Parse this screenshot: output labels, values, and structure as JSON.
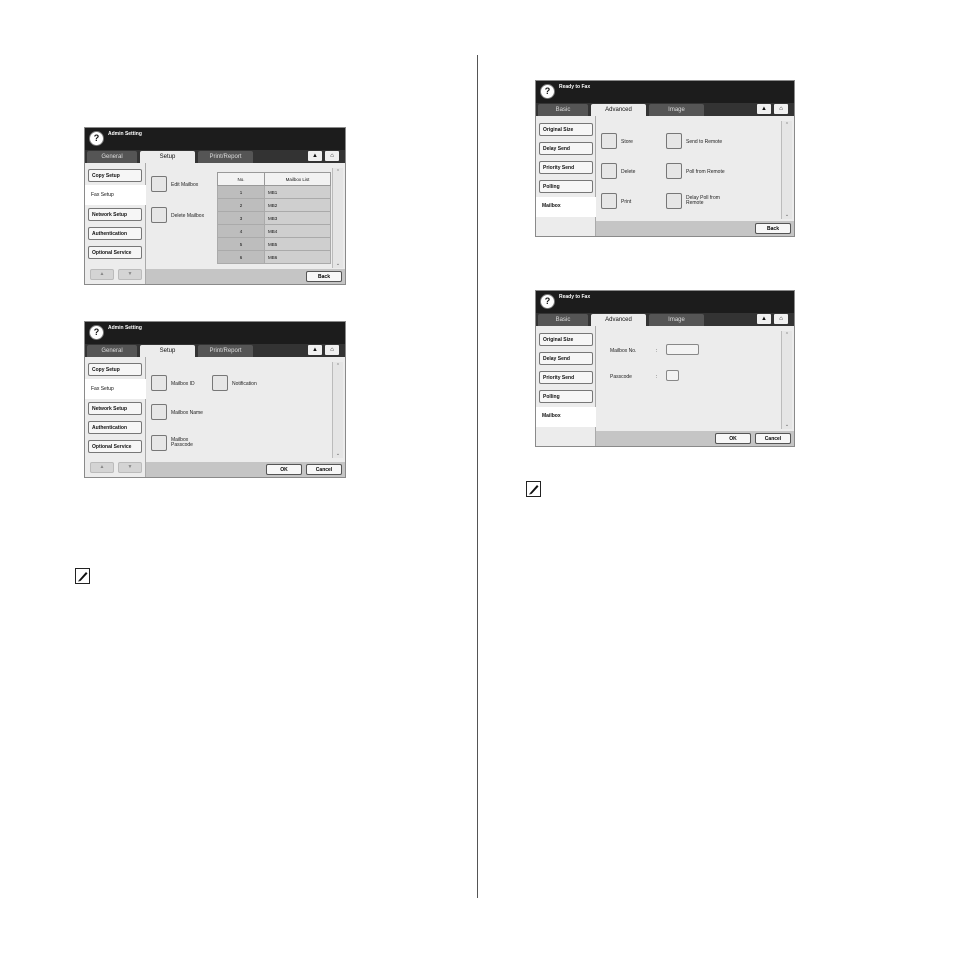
{
  "p1": {
    "title": "Admin Setting",
    "tabs": [
      "General",
      "Setup",
      "Print/Report"
    ],
    "sidebar": [
      "Copy Setup",
      "Fax Setup",
      "Network Setup",
      "Authentication",
      "Optional Service"
    ],
    "buttons": [
      "Edit Mailbox",
      "Delete Mailbox"
    ],
    "table_headers": [
      "No.",
      "Mailbox List"
    ],
    "rows": [
      [
        "1",
        "MB1"
      ],
      [
        "2",
        "MB2"
      ],
      [
        "3",
        "MB3"
      ],
      [
        "4",
        "MB4"
      ],
      [
        "5",
        "MB5"
      ],
      [
        "6",
        "MB6"
      ]
    ],
    "back": "Back"
  },
  "p2": {
    "title": "Admin Setting",
    "tabs": [
      "General",
      "Setup",
      "Print/Report"
    ],
    "sidebar": [
      "Copy Setup",
      "Fax Setup",
      "Network Setup",
      "Authentication",
      "Optional Service"
    ],
    "options": [
      "Mailbox ID",
      "Notification",
      "Mailbox Name",
      "Mailbox\nPasscode"
    ],
    "ok": "OK",
    "cancel": "Cancel"
  },
  "p3": {
    "title": "Ready to Fax",
    "tabs": [
      "Basic",
      "Advanced",
      "Image"
    ],
    "sidebar": [
      "Original Size",
      "Delay Send",
      "Priority Send",
      "Polling",
      "Mailbox"
    ],
    "options": [
      "Store",
      "Send to Remote",
      "Delete",
      "Poll from Remote",
      "Print",
      "Delay Poll from\nRemote"
    ],
    "back": "Back"
  },
  "p4": {
    "title": "Ready to Fax",
    "tabs": [
      "Basic",
      "Advanced",
      "Image"
    ],
    "sidebar": [
      "Original Size",
      "Delay Send",
      "Priority Send",
      "Polling",
      "Mailbox"
    ],
    "fields": [
      {
        "label": "Mailbox No.",
        "sep": ":"
      },
      {
        "label": "Passcode",
        "sep": ":"
      }
    ],
    "ok": "OK",
    "cancel": "Cancel"
  }
}
